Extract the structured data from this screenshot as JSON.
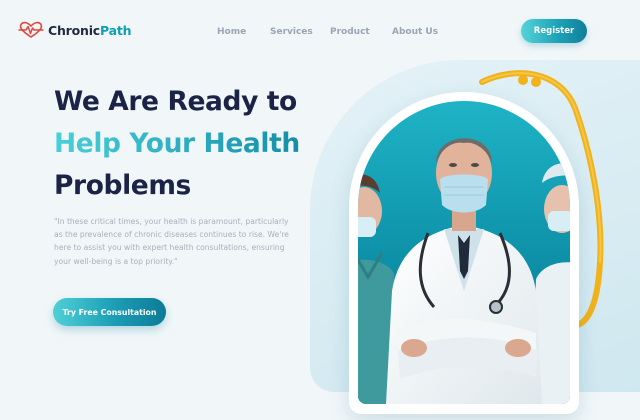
{
  "brand": {
    "name_part1": "Chronic",
    "name_part2": "Path",
    "logo_icon": "heart-pulse-icon"
  },
  "nav": {
    "items": [
      {
        "label": "Home"
      },
      {
        "label": "Services"
      },
      {
        "label": "Product"
      },
      {
        "label": "About Us"
      }
    ],
    "register_label": "Register"
  },
  "hero": {
    "line1": "We Are Ready to",
    "line2": "Help Your Health",
    "line3": "Problems",
    "description": "\"In these critical times, your health is paramount, particularly as the prevalence of chronic diseases continues to rise. We're here to assist you with expert health consultations, ensuring your well-being is a top priority.\"",
    "cta_label": "Try Free Consultation"
  },
  "colors": {
    "accent": "#1ea6b6",
    "heading": "#1b2447",
    "logo_heart": "#e0483b",
    "stethoscope": "#f2b21c"
  }
}
